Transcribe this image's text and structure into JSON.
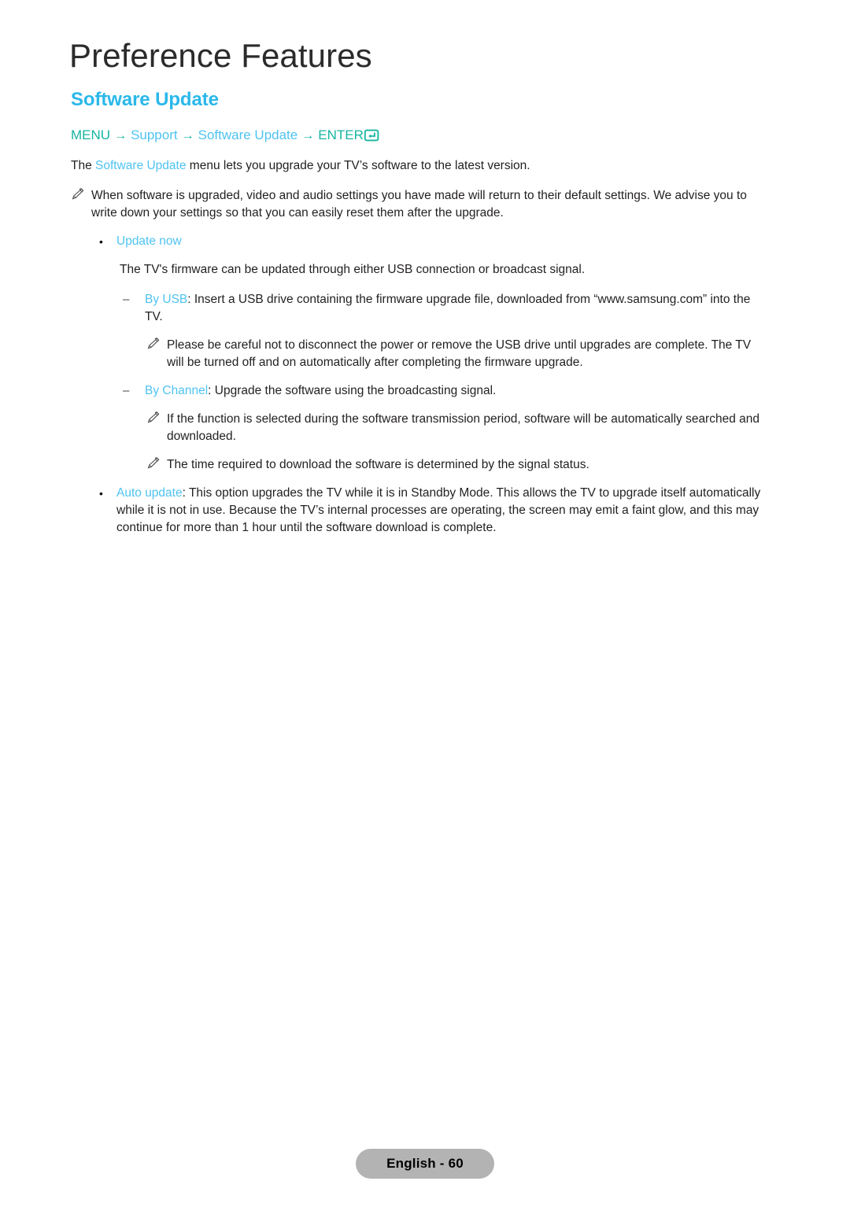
{
  "header": {
    "chapter_title": "Preference Features",
    "section_title": "Software Update"
  },
  "colors": {
    "accent_blue": "#4fc3f0",
    "heading_blue": "#2ab8ea",
    "teal": "#16b5a0",
    "body_text": "#221f1f",
    "footer_badge_bg": "#b3b3b3"
  },
  "menu_path": {
    "step1": "MENU",
    "arrow1": "→",
    "step2": "Support",
    "arrow2": "→",
    "step3": "Software Update",
    "arrow3": "→",
    "step4": "ENTER",
    "enter_icon_name": "enter-key-icon"
  },
  "intro": {
    "before": "The ",
    "highlight": "Software Update",
    "after": " menu lets you upgrade your TV’s software to the latest version."
  },
  "notes": {
    "note1": "When software is upgraded, video and audio settings you have made will return to their default settings. We advise you to write down your settings so that you can easily reset them after the upgrade.",
    "note_usb": "Please be careful not to disconnect the power or remove the USB drive until upgrades are complete. The TV will be turned off and on automatically after completing the firmware upgrade.",
    "note_channel_1": "If the function is selected during the software transmission period, software will be automatically searched and downloaded.",
    "note_channel_2": "The time required to download the software is determined by the signal status."
  },
  "update_now": {
    "bullet": "•",
    "label": "Update now",
    "description": "The TV's firmware can be updated through either USB connection or broadcast signal."
  },
  "by_usb": {
    "dash": "–",
    "label": "By USB",
    "text": ": Insert a USB drive containing the firmware upgrade file, downloaded from “www.samsung.com” into the TV."
  },
  "by_channel": {
    "dash": "–",
    "label": "By Channel",
    "text": ": Upgrade the software using the broadcasting signal."
  },
  "auto_update": {
    "bullet": "•",
    "label": "Auto update",
    "text": ": This option upgrades the TV while it is in Standby Mode. This allows the TV to upgrade itself automatically while it is not in use. Because the TV’s internal processes are operating, the screen may emit a faint glow, and this may continue for more than 1 hour until the software download is complete."
  },
  "footer": {
    "page_label": "English - 60"
  }
}
